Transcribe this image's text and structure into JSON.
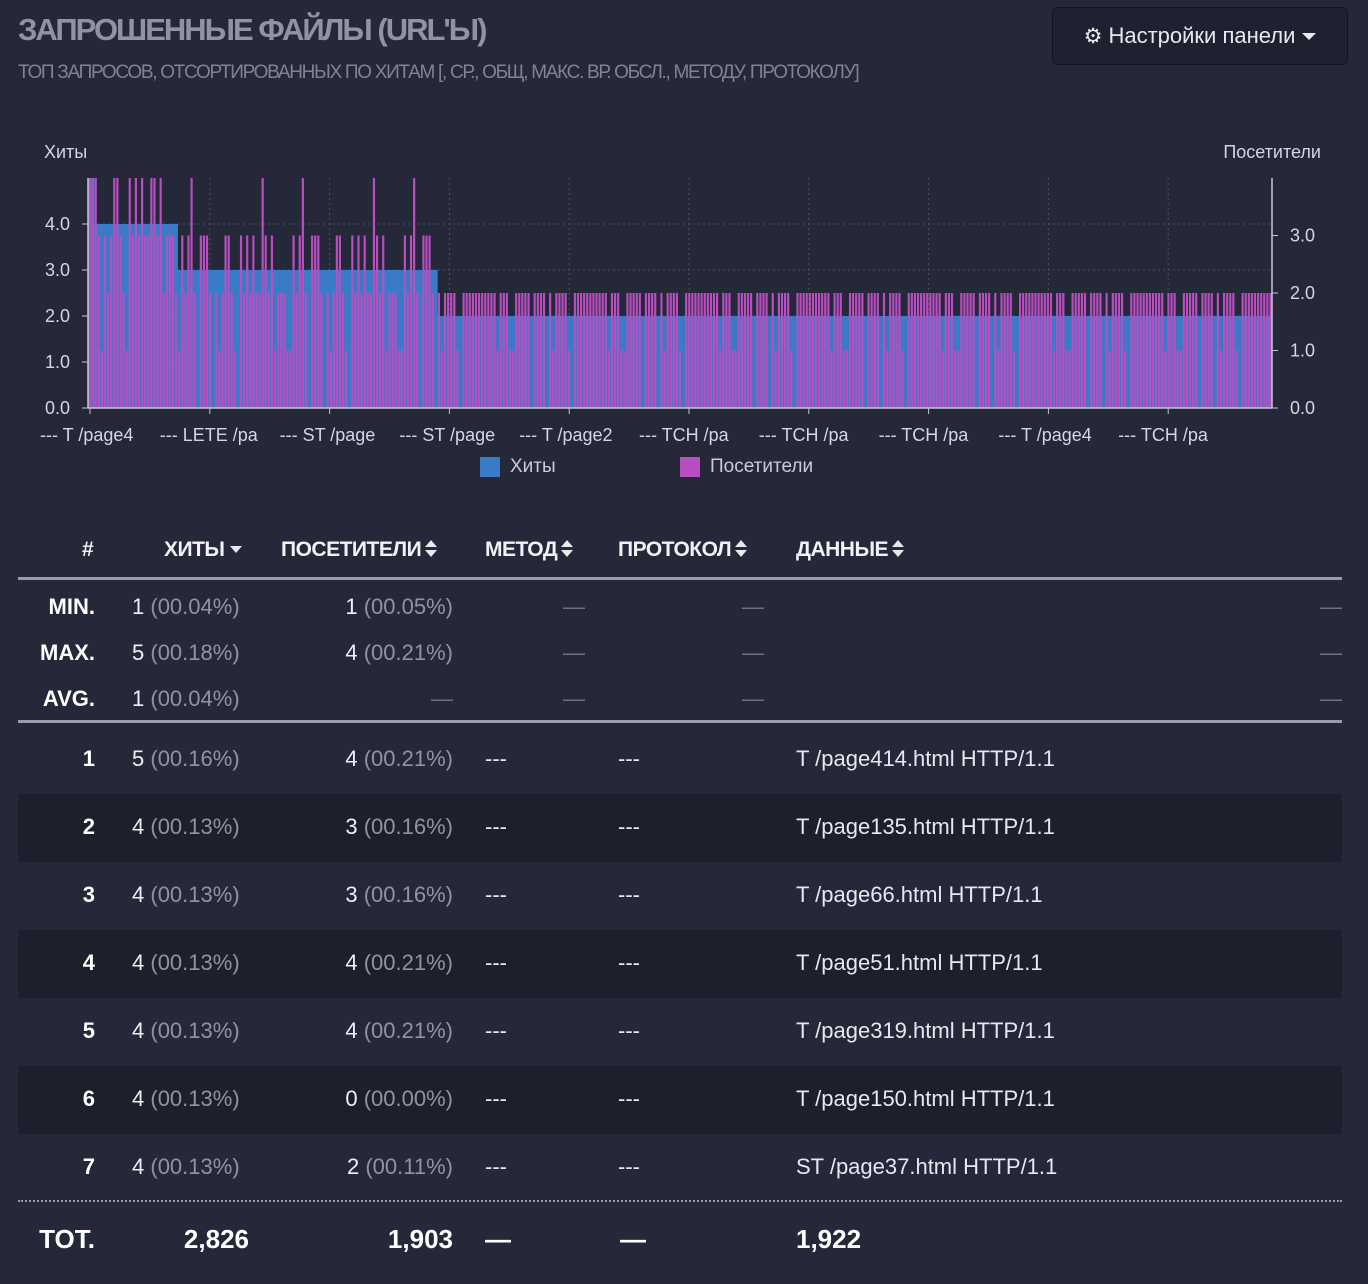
{
  "header": {
    "title": "ЗАПРОШЕННЫЕ ФАЙЛЫ (URL'Ы)",
    "subtitle": "ТОП ЗАПРОСОВ, ОТСОРТИРОВАННЫХ ПО ХИТАМ [, СР., ОБЩ, МАКС. ВР. ОБСЛ., МЕТОДУ, ПРОТОКОЛУ]",
    "settings_label": "Настройки панели",
    "settings_icon": "gear-icon"
  },
  "colors": {
    "hits": "#3a7bc8",
    "visitors": "#b84fc1",
    "background": "#252838"
  },
  "chart_data": {
    "type": "bar",
    "left_axis_label": "Хиты",
    "right_axis_label": "Посетители",
    "left_ticks": [
      "0.0",
      "1.0",
      "2.0",
      "3.0",
      "4.0"
    ],
    "right_ticks": [
      "0.0",
      "1.0",
      "2.0",
      "3.0"
    ],
    "ylim_left": [
      0,
      5
    ],
    "ylim_right": [
      0,
      4
    ],
    "x_tick_labels": [
      "--- T /page4",
      "--- LETE /pa",
      "--- ST /page",
      "--- ST /page",
      "--- T /page2",
      "--- TCH /pa",
      "--- TCH /pa",
      "--- TCH /pa",
      "--- T /page4",
      "--- TCH /pa"
    ],
    "legend": [
      "Хиты",
      "Посетители"
    ],
    "legend_position": "bottom",
    "grid": true,
    "series": [
      {
        "name": "Хиты",
        "segments": [
          {
            "count": 2,
            "value": 5
          },
          {
            "count": 27,
            "value": 4
          },
          {
            "count": 84,
            "value": 3
          },
          {
            "count": 270,
            "value": 2
          }
        ]
      },
      {
        "name": "Посетители",
        "values_description_pattern": [
          3,
          2,
          4,
          2,
          3,
          0,
          2,
          3,
          1,
          2,
          3,
          2,
          2,
          1,
          3,
          2,
          0,
          2,
          3,
          2,
          1,
          2,
          2,
          3
        ]
      }
    ]
  },
  "table": {
    "columns": {
      "idx": "#",
      "hits": "ХИТЫ",
      "visitors": "ПОСЕТИТЕЛИ",
      "method": "МЕТОД",
      "protocol": "ПРОТОКОЛ",
      "data": "ДАННЫЕ"
    },
    "stats": [
      {
        "label": "MIN.",
        "hits": "1",
        "hits_pct": "(00.04%)",
        "visitors": "1",
        "visitors_pct": "(00.05%)"
      },
      {
        "label": "MAX.",
        "hits": "5",
        "hits_pct": "(00.18%)",
        "visitors": "4",
        "visitors_pct": "(00.21%)"
      },
      {
        "label": "AVG.",
        "hits": "1",
        "hits_pct": "(00.04%)",
        "visitors": "",
        "visitors_pct": ""
      }
    ],
    "dash": "—",
    "rows": [
      {
        "idx": "1",
        "hits": "5",
        "hits_pct": "(00.16%)",
        "visitors": "4",
        "visitors_pct": "(00.21%)",
        "method": "---",
        "protocol": "---",
        "data": "T /page414.html HTTP/1.1"
      },
      {
        "idx": "2",
        "hits": "4",
        "hits_pct": "(00.13%)",
        "visitors": "3",
        "visitors_pct": "(00.16%)",
        "method": "---",
        "protocol": "---",
        "data": "T /page135.html HTTP/1.1"
      },
      {
        "idx": "3",
        "hits": "4",
        "hits_pct": "(00.13%)",
        "visitors": "3",
        "visitors_pct": "(00.16%)",
        "method": "---",
        "protocol": "---",
        "data": "T /page66.html HTTP/1.1"
      },
      {
        "idx": "4",
        "hits": "4",
        "hits_pct": "(00.13%)",
        "visitors": "4",
        "visitors_pct": "(00.21%)",
        "method": "---",
        "protocol": "---",
        "data": "T /page51.html HTTP/1.1"
      },
      {
        "idx": "5",
        "hits": "4",
        "hits_pct": "(00.13%)",
        "visitors": "4",
        "visitors_pct": "(00.21%)",
        "method": "---",
        "protocol": "---",
        "data": "T /page319.html HTTP/1.1"
      },
      {
        "idx": "6",
        "hits": "4",
        "hits_pct": "(00.13%)",
        "visitors": "0",
        "visitors_pct": "(00.00%)",
        "method": "---",
        "protocol": "---",
        "data": "T /page150.html HTTP/1.1"
      },
      {
        "idx": "7",
        "hits": "4",
        "hits_pct": "(00.13%)",
        "visitors": "2",
        "visitors_pct": "(00.11%)",
        "method": "---",
        "protocol": "---",
        "data": "ST /page37.html HTTP/1.1"
      }
    ],
    "total": {
      "label": "TOT.",
      "hits": "2,826",
      "visitors": "1,903",
      "method": "—",
      "protocol": "—",
      "data": "1,922"
    }
  }
}
